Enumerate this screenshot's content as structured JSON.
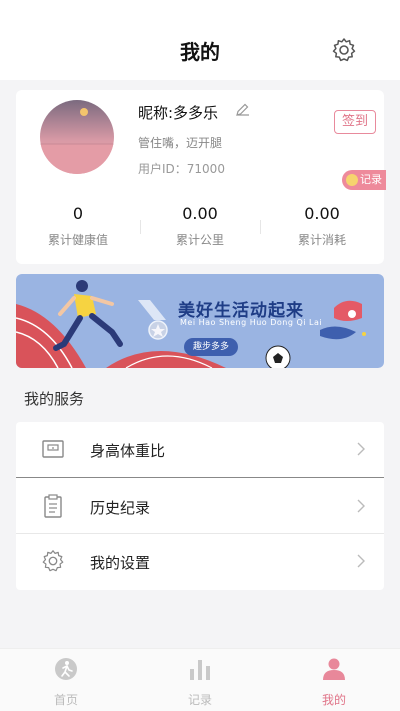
{
  "header": {
    "title": "我的",
    "settings_icon": "gear-icon"
  },
  "profile": {
    "nickname": "昵称:多多乐",
    "slogan": "管住嘴，迈开腿",
    "user_id": "用户ID：71000",
    "signin_label": "签到",
    "record_label": "记录",
    "stats": [
      {
        "value": "0",
        "label": "累计健康值"
      },
      {
        "value": "0.00",
        "label": "累计公里"
      },
      {
        "value": "0.00",
        "label": "累计消耗"
      }
    ]
  },
  "banner": {
    "title": "美好生活动起来",
    "subtitle": "Mei Hao Sheng Huo Dong Qi Lai",
    "button_label": "趣步多多"
  },
  "services": {
    "section_title": "我的服务",
    "items": [
      {
        "label": "身高体重比",
        "icon": "scale-icon"
      },
      {
        "label": "历史纪录",
        "icon": "clipboard-icon"
      },
      {
        "label": "我的设置",
        "icon": "gear-icon"
      }
    ]
  },
  "tabbar": {
    "items": [
      {
        "label": "首页",
        "icon": "running-icon",
        "active": false
      },
      {
        "label": "记录",
        "icon": "bar-chart-icon",
        "active": false
      },
      {
        "label": "我的",
        "icon": "person-icon",
        "active": true
      }
    ]
  },
  "colors": {
    "accent": "#e07488",
    "banner_bg": "#9ab4e2",
    "banner_title": "#1f3d86"
  }
}
